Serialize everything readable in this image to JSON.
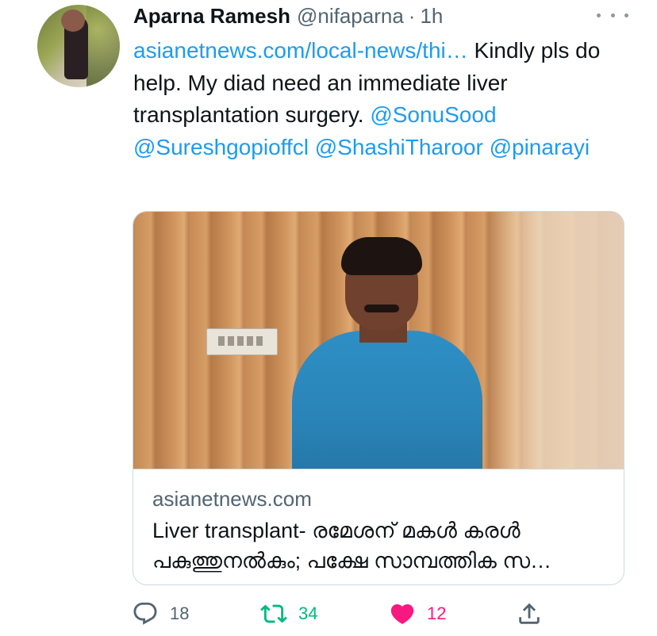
{
  "author": {
    "name": "Aparna Ramesh",
    "handle": "@nifaparna",
    "separator": "·",
    "time": "1h"
  },
  "tweet": {
    "link": "asianetnews.com/local-news/thi…",
    "text_part1": " Kindly pls do help. My diad need an immediate liver transplantation surgery. ",
    "mentions": [
      "@SonuSood",
      "@Sureshgopioffcl",
      "@ShashiTharoor",
      "@pinarayi"
    ]
  },
  "card": {
    "domain": "asianetnews.com",
    "title": "Liver transplant- രമേശന് മകൾ കരൾ പകുത്തുനൽകും; പക്ഷേ സാമ്പത്തിക സ…"
  },
  "actions": {
    "replies": "18",
    "retweets": "34",
    "likes": "12"
  },
  "colors": {
    "link": "#1d9bf0",
    "muted": "#536471",
    "retweet_active": "#00ba7c",
    "like_active": "#f91880"
  },
  "icons": {
    "more": "more-dots-icon",
    "reply": "reply-icon",
    "retweet": "retweet-icon",
    "like": "heart-icon",
    "share": "share-icon"
  }
}
